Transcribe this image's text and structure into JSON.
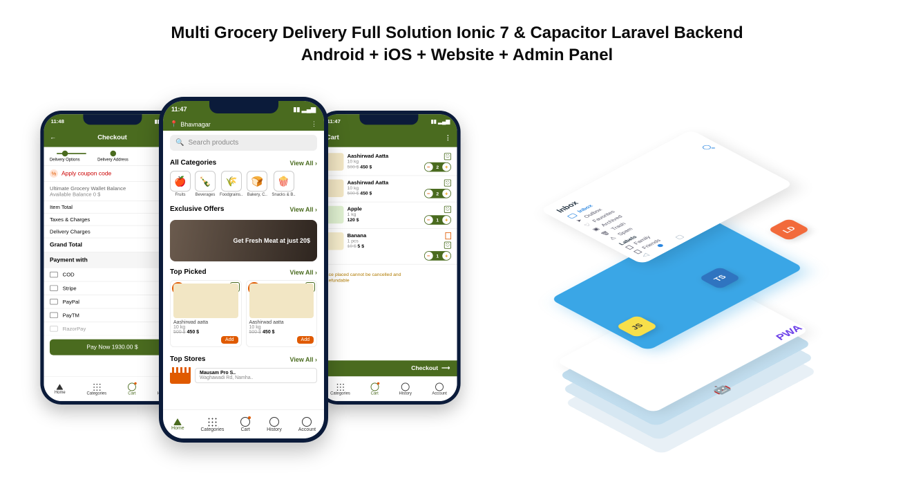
{
  "headline_line1": "Multi Grocery Delivery Full Solution Ionic 7 & Capacitor Laravel Backend",
  "headline_line2": "Android + iOS + Website + Admin Panel",
  "checkout": {
    "time": "11:48",
    "title": "Checkout",
    "step_delivery_options": "Delivery Options",
    "step_delivery_address": "Delivery Address",
    "coupon": "Apply coupon code",
    "wallet_title": "Ultimate Grocery Wallet Balance",
    "wallet_sub": "Available Balance 0 $",
    "item_total": "Item Total",
    "taxes": "Taxes & Charges",
    "delivery_charges": "Delivery Charges",
    "grand_total": "Grand Total",
    "payment_with": "Payment with",
    "methods": [
      "COD",
      "Stripe",
      "PayPal",
      "PayTM",
      "RazorPay"
    ],
    "pay_now": "Pay Now  1930.00 $"
  },
  "home": {
    "time": "11:47",
    "location": "Bhavnagar",
    "search_placeholder": "Search products",
    "all_categories": "All Categories",
    "view_all": "View All ›",
    "cats": [
      "Fruits",
      "Beverages",
      "Foodgrains..",
      "Bakery, C..",
      "Snacks & B.."
    ],
    "exclusive": "Exclusive Offers",
    "banner_text": "Get Fresh Meat at just 20$",
    "top_picked": "Top Picked",
    "discount": "10%",
    "prod_name": "Aashirwad aatta",
    "prod_weight": "10 kg",
    "prod_old": "500 $",
    "prod_price": "450 $",
    "add": "Add",
    "top_stores": "Top Stores",
    "store_name": "Mausam Pro S..",
    "store_sub": "Waghawadi Rd, Namha.."
  },
  "cart": {
    "title": "Cart",
    "items": [
      {
        "name": "Aashirwad Aatta",
        "weight": "10 kg",
        "old": "500 $",
        "price": "450 $",
        "qty": "2"
      },
      {
        "name": "Aashirwad Aatta",
        "weight": "10 kg",
        "old": "500 $",
        "price": "450 $",
        "qty": "2"
      },
      {
        "name": "Apple",
        "weight": "1 kg",
        "old": "",
        "price": "120 $",
        "qty": "1"
      },
      {
        "name": "Banana",
        "weight": "1 pcs",
        "old": "10 $",
        "price": "5 $",
        "qty": "1"
      }
    ],
    "notice1": "..ce placed cannot be cancelled and",
    "notice2": "..efundable",
    "checkout": "Checkout"
  },
  "tabs": {
    "home": "Home",
    "categories": "Categories",
    "cart": "Cart",
    "history": "History",
    "account": "Account"
  },
  "inbox": {
    "title": "Inbox",
    "items": [
      "Inbox",
      "Outbox",
      "Favorites",
      "Archived",
      "Trash",
      "Spam"
    ],
    "labels_head": "Labels",
    "labels": [
      "Family",
      "Friends"
    ]
  },
  "iso": {
    "js": "JS",
    "ts": "TS",
    "ld": "LD",
    "pwa": "PWA"
  }
}
